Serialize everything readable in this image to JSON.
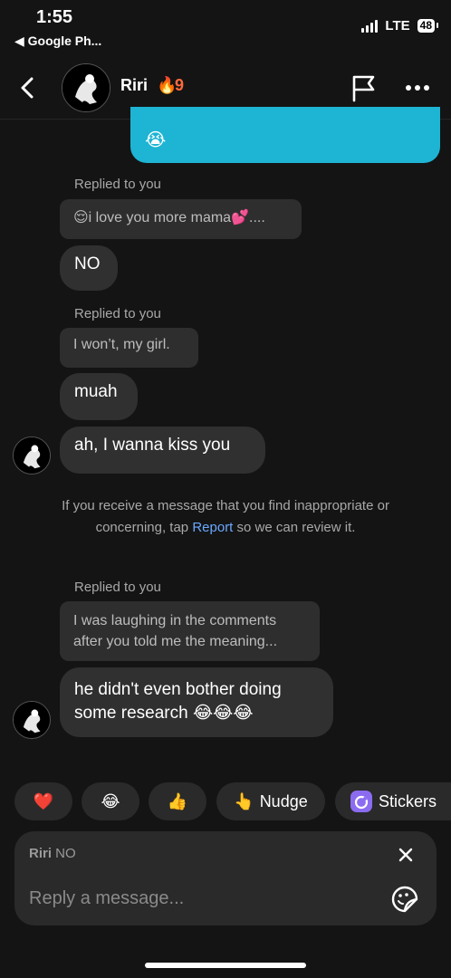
{
  "status_bar": {
    "time": "1:55",
    "back_app": "◀ Google Ph...",
    "network": "LTE",
    "battery": "48"
  },
  "header": {
    "contact_name": "Riri",
    "streak_count": "9"
  },
  "messages": {
    "sent_emoji": "😭",
    "reply_label_1": "Replied to you",
    "quote_1": "😌i love you more mama💕....",
    "msg_no": "NO",
    "reply_label_2": "Replied to you",
    "quote_2": "I won’t, my girl.",
    "msg_muah": "muah",
    "msg_kiss": "ah, I wanna kiss you",
    "reply_label_3": "Replied to you",
    "quote_3_line1": "I was laughing in the comments",
    "quote_3_line2": "after you told me the meaning...",
    "msg_research_line1": "he didn't even bother doing",
    "msg_research_line2": "some research 😂😂😂"
  },
  "notice": {
    "before": "If you receive a message that you find inappropriate or concerning, tap ",
    "link": "Report",
    "after": " so we can review it."
  },
  "reactions": {
    "heart": "❤️",
    "laugh": "😂",
    "thumbs": "👍",
    "nudge_icon": "👆",
    "nudge_label": "Nudge",
    "stickers_label": "Stickers"
  },
  "composer": {
    "replying_name": "Riri",
    "replying_text": " NO",
    "placeholder": "Reply a message..."
  },
  "colors": {
    "background": "#141414",
    "sent_bubble": "#1eb4d4",
    "received_bubble": "#303030",
    "link": "#6aa8ff",
    "streak": "#ff6a3d"
  }
}
